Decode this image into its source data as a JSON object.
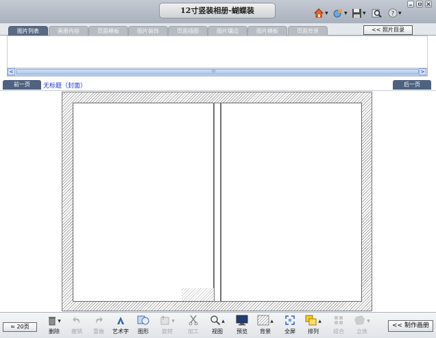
{
  "window": {
    "title": "12寸竖装相册-蝴蝶装",
    "icons": [
      "home-icon",
      "colorize-icon",
      "save-icon",
      "search-icon",
      "help-icon"
    ],
    "controls": [
      "minimize-icon",
      "restore-icon",
      "close-icon"
    ]
  },
  "tabs": [
    {
      "label": "图片列表",
      "active": true
    },
    {
      "label": "画册内容",
      "active": false
    },
    {
      "label": "页面模板",
      "active": false
    },
    {
      "label": "图片装饰",
      "active": false
    },
    {
      "label": "页面插图",
      "active": false
    },
    {
      "label": "图片镶边",
      "active": false
    },
    {
      "label": "图片模板",
      "active": false
    },
    {
      "label": "页面背景",
      "active": false
    }
  ],
  "photo_directory_button": "<< 照片目录",
  "scrollbar": {
    "grip": "III",
    "left_arrow": "<",
    "right_arrow": ">"
  },
  "page_nav": {
    "prev_label": "前一页",
    "next_label": "后一页",
    "page_title": "无标题（封面）"
  },
  "bottom_bar": {
    "pages_label": "≈ 20页",
    "make_album_label": "<< 制作画册",
    "tools": [
      {
        "name": "delete",
        "label": "删除",
        "icon": "trash-icon",
        "enabled": true
      },
      {
        "name": "undo",
        "label": "撤销",
        "icon": "undo-icon",
        "enabled": false
      },
      {
        "name": "redo",
        "label": "重做",
        "icon": "redo-icon",
        "enabled": false
      },
      {
        "name": "art-text",
        "label": "艺术字",
        "icon": "art-text-icon",
        "enabled": true
      },
      {
        "name": "shape",
        "label": "图形",
        "icon": "shape-icon",
        "enabled": true
      },
      {
        "name": "rotate",
        "label": "旋转",
        "icon": "rotate-icon",
        "enabled": false
      },
      {
        "name": "edit",
        "label": "加工",
        "icon": "scissors-icon",
        "enabled": false
      },
      {
        "name": "view",
        "label": "视图",
        "icon": "magnifier-icon",
        "enabled": true
      },
      {
        "name": "preview",
        "label": "预览",
        "icon": "monitor-icon",
        "enabled": true
      },
      {
        "name": "background",
        "label": "背景",
        "icon": "background-icon",
        "enabled": true
      },
      {
        "name": "fullscreen",
        "label": "全屏",
        "icon": "fullscreen-icon",
        "enabled": true
      },
      {
        "name": "arrange",
        "label": "排列",
        "icon": "arrange-icon",
        "enabled": true
      },
      {
        "name": "group",
        "label": "组合",
        "icon": "group-icon",
        "enabled": false
      },
      {
        "name": "solid",
        "label": "立体",
        "icon": "solid-icon",
        "enabled": false
      }
    ]
  },
  "colors": {
    "tab_active": "#5a6a83",
    "nav_button": "#4f6280",
    "page_title_link": "#2233cc"
  }
}
